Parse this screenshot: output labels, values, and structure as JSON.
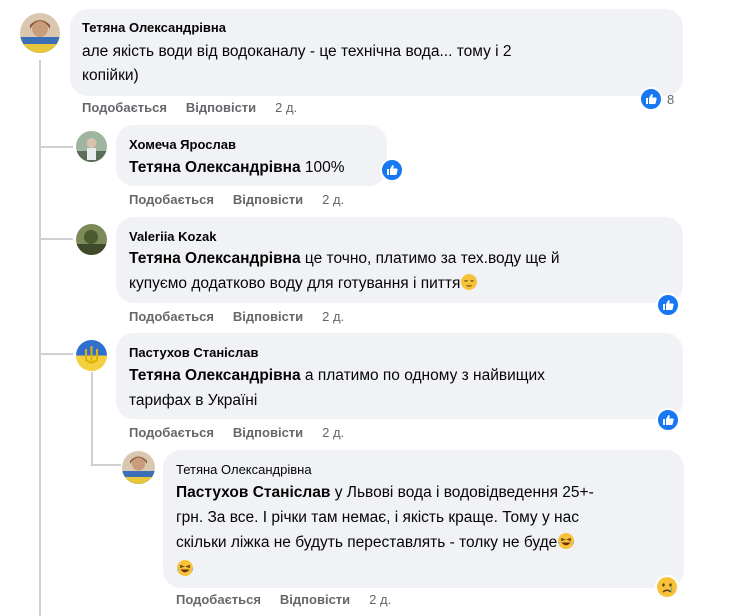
{
  "comments": [
    {
      "author": "Тетяна Олександрівна",
      "text_line1": "але якість води від водоканалу - це технічна вода... тому і 2",
      "text_line2": "копійки)",
      "reactions_count": "8",
      "like_label": "Подобається",
      "reply_label": "Відповісти",
      "time": "2 д."
    },
    {
      "author": "Хомеча Ярослав",
      "mention": "Тетяна Олександрівна",
      "text": " 100%",
      "like_label": "Подобається",
      "reply_label": "Відповісти",
      "time": "2 д."
    },
    {
      "author": "Valeriia Kozak",
      "mention": "Тетяна Олександрівна",
      "text_line1": " це точно, платимо за тех.воду ще й",
      "text_line2": "купуємо додатково воду для готування і пиття",
      "like_label": "Подобається",
      "reply_label": "Відповісти",
      "time": "2 д."
    },
    {
      "author": "Пастухов Станіслав",
      "mention": "Тетяна Олександрівна",
      "text_line1": " а платимо по одному з найвищих",
      "text_line2": "тарифах в Україні",
      "like_label": "Подобається",
      "reply_label": "Відповісти",
      "time": "2 д."
    },
    {
      "author": "Тетяна Олександрівна",
      "mention": "Пастухов Станіслав",
      "text_line1": " у Львові вода і водовідведення 25+-",
      "text_line2": "грн. За все. І річки там немає, і якість краще. Тому у нас",
      "text_line3": "скільки ліжка не будуть переставлять - толку не буде",
      "like_label": "Подобається",
      "reply_label": "Відповісти",
      "time": "2 д."
    }
  ],
  "colors": {
    "bubble": "#f0f2f5",
    "like_blue": "#1877f2",
    "meta_gray": "#65676b",
    "thread_line": "#ced0d4"
  }
}
